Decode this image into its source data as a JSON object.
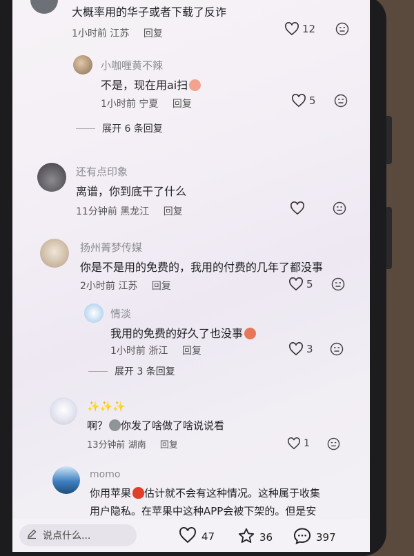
{
  "comments": [
    {
      "text": "大概率用的华子或者下载了反诈",
      "time": "1小时前",
      "location": "江苏",
      "reply": "回复",
      "likes": "12"
    },
    {
      "name": "小咖喱黄不辣",
      "text": "不是，现在用ai扫",
      "time": "1小时前",
      "location": "宁夏",
      "reply": "回复",
      "likes": "5"
    },
    {
      "name": "还有点印象",
      "text": "离谱，你到底干了什么",
      "time": "11分钟前",
      "location": "黑龙江",
      "reply": "回复",
      "likes": ""
    },
    {
      "name": "扬州菁梦传媒",
      "text": "你是不是用的免费的，我用的付费的几年了都没事",
      "time": "2小时前",
      "location": "江苏",
      "reply": "回复",
      "likes": "5"
    },
    {
      "name": "情淡",
      "text": "我用的免费的好久了也没事",
      "time": "1小时前",
      "location": "浙江",
      "reply": "回复",
      "likes": "3"
    },
    {
      "name": "✨✨✨",
      "text_a": "啊？",
      "text_b": "你发了啥做了啥说说看",
      "time": "13分钟前",
      "location": "湖南",
      "reply": "回复",
      "likes": "1"
    },
    {
      "name": "momo",
      "text_a": "你用苹果",
      "text_b": "估计就不会有这种情况。这种属于收集",
      "line2": "用户隐私。在苹果中这种APP会被下架的。但是安"
    }
  ],
  "expand_1": "展开 6 条回复",
  "expand_2": "展开 3 条回复",
  "icons": {
    "like": "heart-outline-icon",
    "dislike": "meh-face-icon",
    "star": "star-outline-icon",
    "comment": "speech-bubble-icon",
    "edit": "pencil-icon"
  },
  "bottom": {
    "placeholder": "说点什么...",
    "likes": "47",
    "stars": "36",
    "comments": "397"
  }
}
